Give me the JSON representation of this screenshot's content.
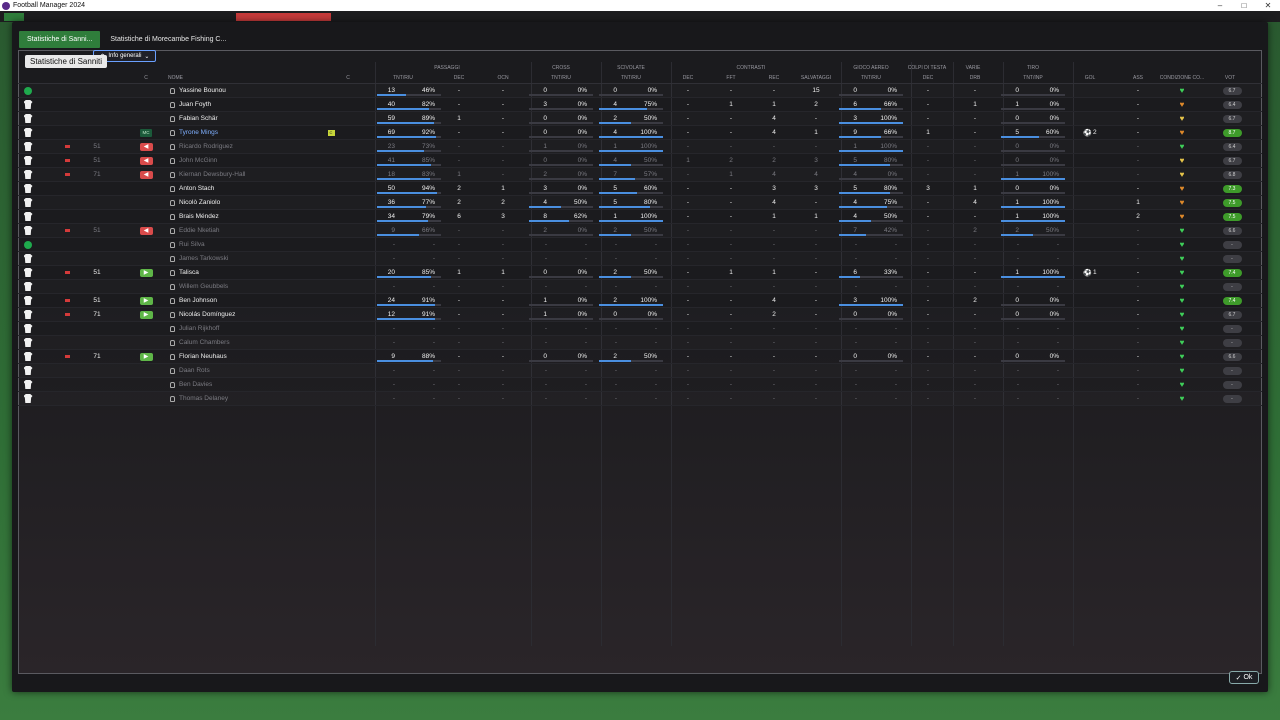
{
  "window": {
    "title": "Football Manager 2024"
  },
  "tabs": [
    {
      "label": "Statistiche di Sanni..."
    },
    {
      "label": "Statistiche di Morecambe Fishing C..."
    }
  ],
  "tooltip": "Statistiche di Sanniti",
  "view_select": "Info generali",
  "ok_label": "Ok",
  "group_headers": {
    "passaggi": "PASSAGGI",
    "cross": "CROSS",
    "scivolate": "SCIVOLATE",
    "contrasti": "CONTRASTI",
    "gioco_aereo": "GIOCO AEREO",
    "colpi_di_testa": "COLPI DI TESTA",
    "varie": "VARIE",
    "tiro": "TIRO"
  },
  "col_headers": {
    "c": "C",
    "name": "NOME",
    "c2": "C",
    "pass_tr": "TNT/RIU",
    "pass_dec": "DEC",
    "pass_ocn": "OCN",
    "cross_tr": "TNT/RIU",
    "sciv_tr": "TNT/RIU",
    "contr_dec": "DEC",
    "contr_fft": "FFT",
    "contr_rec": "REC",
    "salvataggi": "SALVATAGGI",
    "aereo_tr": "TNT/RIU",
    "testa_dec": "DEC",
    "drb": "DRB",
    "tiro_tr": "TNT/INP",
    "gol": "GOL",
    "ass": "ASS",
    "condizione": "CONDIZIONE CO...",
    "vot": "VOT"
  },
  "players": [
    {
      "name": "Yassine Bounou",
      "lead": "dot",
      "dim": false,
      "pass": [
        "13",
        "46%"
      ],
      "pdec": "-",
      "pocn": "-",
      "cross": [
        "0",
        "0%"
      ],
      "sciv": [
        "0",
        "0%"
      ],
      "cdec": "-",
      "cfft": "-",
      "crec": "-",
      "salv": "15",
      "aereo": [
        "0",
        "0%"
      ],
      "tdec": "-",
      "drb": "-",
      "tiro": [
        "0",
        "0%"
      ],
      "gol": "",
      "ass": "-",
      "heart": "green",
      "vot": "6.7",
      "good": false,
      "p": [
        46,
        0,
        0,
        0,
        0
      ]
    },
    {
      "name": "Juan Foyth",
      "lead": "shirt",
      "dim": false,
      "pass": [
        "40",
        "82%"
      ],
      "pdec": "-",
      "pocn": "-",
      "cross": [
        "3",
        "0%"
      ],
      "sciv": [
        "4",
        "75%"
      ],
      "cdec": "-",
      "cfft": "1",
      "crec": "1",
      "salv": "2",
      "aereo": [
        "6",
        "66%"
      ],
      "tdec": "-",
      "drb": "1",
      "tiro": [
        "1",
        "0%"
      ],
      "gol": "",
      "ass": "-",
      "heart": "orange",
      "vot": "6.4",
      "good": false,
      "p": [
        82,
        0,
        75,
        66,
        0
      ]
    },
    {
      "name": "Fabian Schär",
      "lead": "shirt",
      "dim": false,
      "pass": [
        "59",
        "89%"
      ],
      "pdec": "1",
      "pocn": "-",
      "cross": [
        "0",
        "0%"
      ],
      "sciv": [
        "2",
        "50%"
      ],
      "cdec": "-",
      "cfft": "-",
      "crec": "4",
      "salv": "-",
      "aereo": [
        "3",
        "100%"
      ],
      "tdec": "-",
      "drb": "-",
      "tiro": [
        "0",
        "0%"
      ],
      "gol": "",
      "ass": "-",
      "heart": "yellow",
      "vot": "6.7",
      "good": false,
      "p": [
        89,
        0,
        50,
        100,
        0
      ]
    },
    {
      "name": "Tyrone Mings",
      "lead": "shirt",
      "pos": "MC",
      "card": "yellow",
      "link": true,
      "dim": false,
      "pass": [
        "69",
        "92%"
      ],
      "pdec": "-",
      "pocn": "-",
      "cross": [
        "0",
        "0%"
      ],
      "sciv": [
        "4",
        "100%"
      ],
      "cdec": "-",
      "cfft": "-",
      "crec": "4",
      "salv": "1",
      "aereo": [
        "9",
        "66%"
      ],
      "tdec": "1",
      "drb": "-",
      "tiro": [
        "5",
        "60%"
      ],
      "gol": "2",
      "ass": "-",
      "heart": "orange",
      "vot": "8.7",
      "good": true,
      "p": [
        92,
        0,
        100,
        66,
        60
      ]
    },
    {
      "name": "Ricardo Rodriguez",
      "lead": "shirt",
      "sub": "out",
      "min": "51",
      "dim": true,
      "pass": [
        "23",
        "73%"
      ],
      "pdec": "-",
      "pocn": "-",
      "cross": [
        "1",
        "0%"
      ],
      "sciv": [
        "1",
        "100%"
      ],
      "cdec": "-",
      "cfft": "-",
      "crec": "-",
      "salv": "-",
      "aereo": [
        "1",
        "100%"
      ],
      "tdec": "-",
      "drb": "-",
      "tiro": [
        "0",
        "0%"
      ],
      "gol": "",
      "ass": "-",
      "heart": "green",
      "vot": "6.4",
      "good": false,
      "p": [
        73,
        0,
        100,
        100,
        0
      ]
    },
    {
      "name": "John McGinn",
      "lead": "shirt",
      "sub": "out",
      "min": "51",
      "dim": true,
      "pass": [
        "41",
        "85%"
      ],
      "pdec": "-",
      "pocn": "-",
      "cross": [
        "0",
        "0%"
      ],
      "sciv": [
        "4",
        "50%"
      ],
      "cdec": "1",
      "cfft": "2",
      "crec": "2",
      "salv": "3",
      "aereo": [
        "5",
        "80%"
      ],
      "tdec": "-",
      "drb": "-",
      "tiro": [
        "0",
        "0%"
      ],
      "gol": "",
      "ass": "-",
      "heart": "yellow",
      "vot": "6.7",
      "good": false,
      "p": [
        85,
        0,
        50,
        80,
        0
      ]
    },
    {
      "name": "Kiernan Dewsbury-Hall",
      "lead": "shirt",
      "sub": "out",
      "min": "71",
      "dim": true,
      "pass": [
        "18",
        "83%"
      ],
      "pdec": "1",
      "pocn": "-",
      "cross": [
        "2",
        "0%"
      ],
      "sciv": [
        "7",
        "57%"
      ],
      "cdec": "-",
      "cfft": "1",
      "crec": "4",
      "salv": "4",
      "aereo": [
        "4",
        "0%"
      ],
      "tdec": "-",
      "drb": "-",
      "tiro": [
        "1",
        "100%"
      ],
      "gol": "",
      "ass": "-",
      "heart": "yellow",
      "vot": "6.8",
      "good": false,
      "p": [
        83,
        0,
        57,
        0,
        100
      ]
    },
    {
      "name": "Anton Stach",
      "lead": "shirt",
      "dim": false,
      "pass": [
        "50",
        "94%"
      ],
      "pdec": "2",
      "pocn": "1",
      "cross": [
        "3",
        "0%"
      ],
      "sciv": [
        "5",
        "60%"
      ],
      "cdec": "-",
      "cfft": "-",
      "crec": "3",
      "salv": "3",
      "aereo": [
        "5",
        "80%"
      ],
      "tdec": "3",
      "drb": "1",
      "tiro": [
        "0",
        "0%"
      ],
      "gol": "",
      "ass": "-",
      "heart": "orange",
      "vot": "7.3",
      "good": true,
      "p": [
        94,
        0,
        60,
        80,
        0
      ]
    },
    {
      "name": "Nicolò Zaniolo",
      "lead": "shirt",
      "dim": false,
      "pass": [
        "36",
        "77%"
      ],
      "pdec": "2",
      "pocn": "2",
      "cross": [
        "4",
        "50%"
      ],
      "sciv": [
        "5",
        "80%"
      ],
      "cdec": "-",
      "cfft": "-",
      "crec": "4",
      "salv": "-",
      "aereo": [
        "4",
        "75%"
      ],
      "tdec": "-",
      "drb": "4",
      "tiro": [
        "1",
        "100%"
      ],
      "gol": "",
      "ass": "1",
      "heart": "orange",
      "vot": "7.5",
      "good": true,
      "p": [
        77,
        50,
        80,
        75,
        100
      ]
    },
    {
      "name": "Brais Méndez",
      "lead": "shirt",
      "dim": false,
      "pass": [
        "34",
        "79%"
      ],
      "pdec": "6",
      "pocn": "3",
      "cross": [
        "8",
        "62%"
      ],
      "sciv": [
        "1",
        "100%"
      ],
      "cdec": "-",
      "cfft": "-",
      "crec": "1",
      "salv": "1",
      "aereo": [
        "4",
        "50%"
      ],
      "tdec": "-",
      "drb": "-",
      "tiro": [
        "1",
        "100%"
      ],
      "gol": "",
      "ass": "2",
      "heart": "orange",
      "vot": "7.5",
      "good": true,
      "p": [
        79,
        62,
        100,
        50,
        100
      ]
    },
    {
      "name": "Eddie Nketiah",
      "lead": "shirt",
      "sub": "out",
      "min": "51",
      "dim": true,
      "pass": [
        "9",
        "66%"
      ],
      "pdec": "-",
      "pocn": "-",
      "cross": [
        "2",
        "0%"
      ],
      "sciv": [
        "2",
        "50%"
      ],
      "cdec": "-",
      "cfft": "-",
      "crec": "-",
      "salv": "-",
      "aereo": [
        "7",
        "42%"
      ],
      "tdec": "-",
      "drb": "2",
      "tiro": [
        "2",
        "50%"
      ],
      "gol": "",
      "ass": "-",
      "heart": "green",
      "vot": "6.6",
      "good": false,
      "p": [
        66,
        0,
        50,
        42,
        50
      ]
    },
    {
      "name": "Rui Silva",
      "lead": "dot",
      "dim": true,
      "empty": true,
      "heart": "green",
      "vot": "-",
      "good": false
    },
    {
      "name": "James Tarkowski",
      "lead": "shirt",
      "dim": true,
      "empty": true,
      "heart": "green",
      "vot": "-",
      "good": false
    },
    {
      "name": "Talisca",
      "lead": "shirt",
      "sub": "in",
      "min": "51",
      "red": true,
      "dim": false,
      "pass": [
        "20",
        "85%"
      ],
      "pdec": "1",
      "pocn": "1",
      "cross": [
        "0",
        "0%"
      ],
      "sciv": [
        "2",
        "50%"
      ],
      "cdec": "-",
      "cfft": "1",
      "crec": "1",
      "salv": "-",
      "aereo": [
        "6",
        "33%"
      ],
      "tdec": "-",
      "drb": "-",
      "tiro": [
        "1",
        "100%"
      ],
      "gol": "1",
      "ass": "-",
      "heart": "green",
      "vot": "7.4",
      "good": true,
      "p": [
        85,
        0,
        50,
        33,
        100
      ]
    },
    {
      "name": "Willem Geubbels",
      "lead": "shirt",
      "dim": true,
      "empty": true,
      "heart": "green",
      "vot": "-",
      "good": false
    },
    {
      "name": "Ben Johnson",
      "lead": "shirt",
      "sub": "in",
      "min": "51",
      "red": true,
      "dim": false,
      "pass": [
        "24",
        "91%"
      ],
      "pdec": "-",
      "pocn": "-",
      "cross": [
        "1",
        "0%"
      ],
      "sciv": [
        "2",
        "100%"
      ],
      "cdec": "-",
      "cfft": "-",
      "crec": "4",
      "salv": "-",
      "aereo": [
        "3",
        "100%"
      ],
      "tdec": "-",
      "drb": "2",
      "tiro": [
        "0",
        "0%"
      ],
      "gol": "",
      "ass": "-",
      "heart": "green",
      "vot": "7.4",
      "good": true,
      "p": [
        91,
        0,
        100,
        100,
        0
      ]
    },
    {
      "name": "Nicolás Domínguez",
      "lead": "shirt",
      "sub": "in",
      "min": "71",
      "red": true,
      "dim": false,
      "pass": [
        "12",
        "91%"
      ],
      "pdec": "-",
      "pocn": "-",
      "cross": [
        "1",
        "0%"
      ],
      "sciv": [
        "0",
        "0%"
      ],
      "cdec": "-",
      "cfft": "-",
      "crec": "2",
      "salv": "-",
      "aereo": [
        "0",
        "0%"
      ],
      "tdec": "-",
      "drb": "-",
      "tiro": [
        "0",
        "0%"
      ],
      "gol": "",
      "ass": "-",
      "heart": "green",
      "vot": "6.7",
      "good": false,
      "p": [
        91,
        0,
        0,
        0,
        0
      ]
    },
    {
      "name": "Julian Rijkhoff",
      "lead": "shirt",
      "dim": true,
      "empty": true,
      "heart": "green",
      "vot": "-",
      "good": false
    },
    {
      "name": "Calum Chambers",
      "lead": "shirt",
      "dim": true,
      "empty": true,
      "heart": "green",
      "vot": "-",
      "good": false
    },
    {
      "name": "Florian Neuhaus",
      "lead": "shirt",
      "sub": "in",
      "min": "71",
      "red": true,
      "dim": false,
      "pass": [
        "9",
        "88%"
      ],
      "pdec": "-",
      "pocn": "-",
      "cross": [
        "0",
        "0%"
      ],
      "sciv": [
        "2",
        "50%"
      ],
      "cdec": "-",
      "cfft": "-",
      "crec": "-",
      "salv": "-",
      "aereo": [
        "0",
        "0%"
      ],
      "tdec": "-",
      "drb": "-",
      "tiro": [
        "0",
        "0%"
      ],
      "gol": "",
      "ass": "-",
      "heart": "green",
      "vot": "6.6",
      "good": false,
      "p": [
        88,
        0,
        50,
        0,
        0
      ]
    },
    {
      "name": "Daan Rots",
      "lead": "shirt",
      "dim": true,
      "empty": true,
      "heart": "green",
      "vot": "-",
      "good": false
    },
    {
      "name": "Ben Davies",
      "lead": "shirt",
      "dim": true,
      "empty": true,
      "heart": "green",
      "vot": "-",
      "good": false
    },
    {
      "name": "Thomas Delaney",
      "lead": "shirt",
      "dim": true,
      "empty": true,
      "heart": "green",
      "vot": "-",
      "good": false
    }
  ]
}
